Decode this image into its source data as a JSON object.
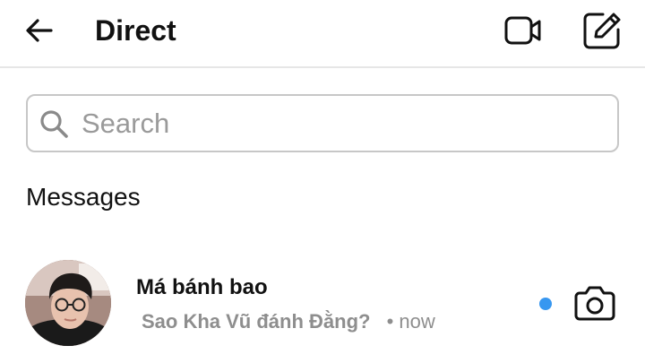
{
  "header": {
    "back_icon": "arrow-left-icon",
    "title": "Direct",
    "video_icon": "video-camera-icon",
    "compose_icon": "new-message-icon"
  },
  "search": {
    "icon": "search-icon",
    "placeholder": "Search",
    "value": ""
  },
  "messages": {
    "section_title": "Messages",
    "threads": [
      {
        "name": "Má bánh bao",
        "preview": "Sao Kha Vũ đánh Đằng?",
        "time": "• now",
        "unread": true,
        "avatar_icon": "avatar",
        "action_icon": "camera-icon"
      }
    ]
  },
  "colors": {
    "text_primary": "#111111",
    "text_secondary": "#8e8e8e",
    "unread_dot": "#3797f0",
    "border": "#c7c7c7"
  }
}
